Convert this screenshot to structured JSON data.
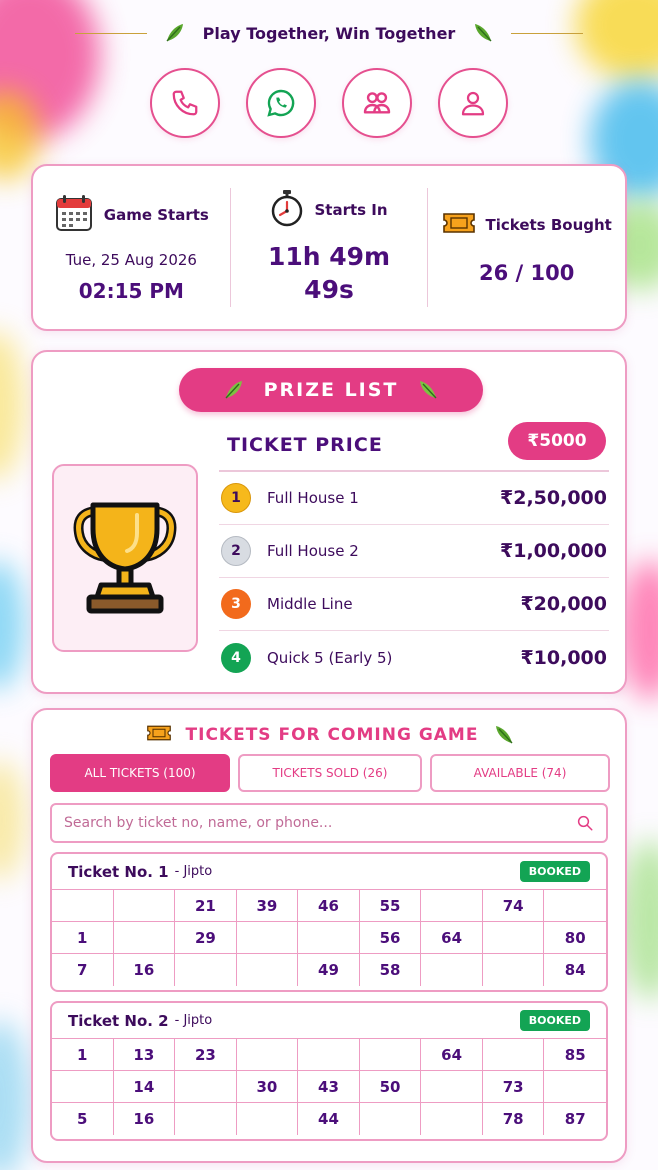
{
  "header": {
    "title": "Play Together, Win Together"
  },
  "actions": [
    {
      "name": "phone-icon",
      "label": "Call"
    },
    {
      "name": "whatsapp-icon",
      "label": "WhatsApp"
    },
    {
      "name": "group-icon",
      "label": "Group"
    },
    {
      "name": "profile-icon",
      "label": "Profile"
    }
  ],
  "info": {
    "game_starts_label": "Game Starts",
    "game_date": "Tue, 25 Aug 2026",
    "game_time": "02:15 PM",
    "starts_in_label": "Starts In",
    "countdown_hm": "11h 49m",
    "countdown_s": "49s",
    "tickets_label": "Tickets Bought",
    "tickets_value": "26 / 100"
  },
  "prize": {
    "title": "PRIZE LIST",
    "ticket_price_label": "TICKET PRICE",
    "ticket_price": "₹5000",
    "items": [
      {
        "rank": "1",
        "name": "Full House 1",
        "amount": "₹2,50,000",
        "color": "#f6b91c"
      },
      {
        "rank": "2",
        "name": "Full House 2",
        "amount": "₹1,00,000",
        "color": "#d8dce2"
      },
      {
        "rank": "3",
        "name": "Middle Line",
        "amount": "₹20,000",
        "color": "#f26a1c"
      },
      {
        "rank": "4",
        "name": "Quick 5 (Early 5)",
        "amount": "₹10,000",
        "color": "#13a454"
      }
    ]
  },
  "tickets_section": {
    "title": "TICKETS FOR COMING GAME",
    "tabs": [
      {
        "label": "ALL TICKETS (100)",
        "active": true
      },
      {
        "label": "TICKETS SOLD (26)",
        "active": false
      },
      {
        "label": "AVAILABLE (74)",
        "active": false
      }
    ],
    "search_placeholder": "Search by ticket no, name, or phone...",
    "tickets": [
      {
        "title": "Ticket No. 1",
        "owner": "- Jipto",
        "status": "BOOKED",
        "rows": [
          [
            "",
            "",
            "21",
            "39",
            "46",
            "55",
            "",
            "74",
            ""
          ],
          [
            "1",
            "",
            "29",
            "",
            "",
            "56",
            "64",
            "",
            "80"
          ],
          [
            "7",
            "16",
            "",
            "",
            "49",
            "58",
            "",
            "",
            "84"
          ]
        ]
      },
      {
        "title": "Ticket No. 2",
        "owner": "- Jipto",
        "status": "BOOKED",
        "rows": [
          [
            "1",
            "13",
            "23",
            "",
            "",
            "",
            "64",
            "",
            "85"
          ],
          [
            "",
            "14",
            "",
            "30",
            "43",
            "50",
            "",
            "73",
            ""
          ],
          [
            "5",
            "16",
            "",
            "",
            "44",
            "",
            "",
            "78",
            "87"
          ]
        ]
      }
    ]
  },
  "colors": {
    "accent": "#e33c84",
    "text": "#3d0b5c",
    "border": "#ee9cc3",
    "booked": "#13a454"
  }
}
